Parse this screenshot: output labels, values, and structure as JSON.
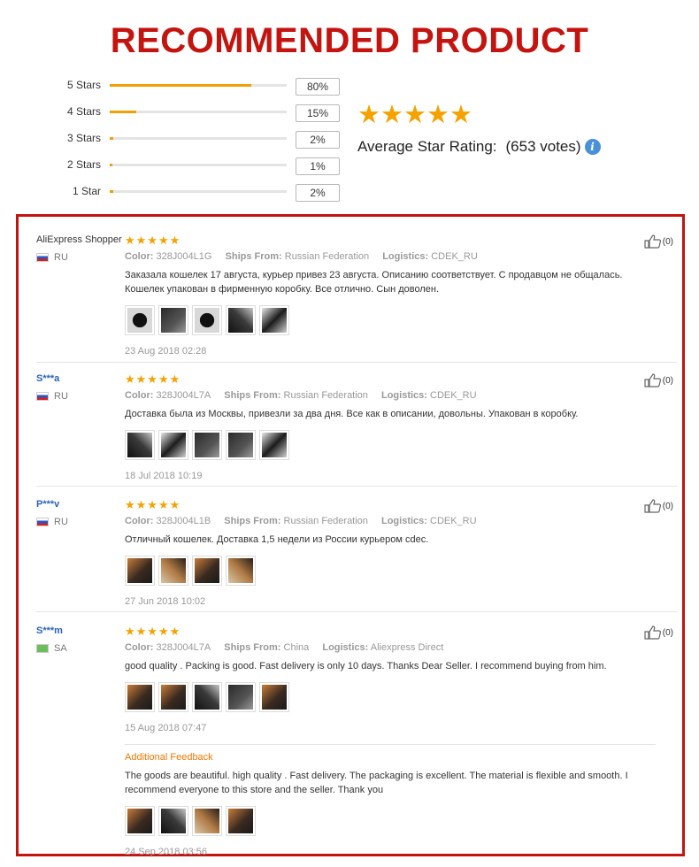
{
  "headline": "RECOMMENDED PRODUCT",
  "rating_breakdown": [
    {
      "label": "5 Stars",
      "percent_text": "80%",
      "fill": 0.8
    },
    {
      "label": "4 Stars",
      "percent_text": "15%",
      "fill": 0.15
    },
    {
      "label": "3 Stars",
      "percent_text": "2%",
      "fill": 0.02
    },
    {
      "label": "2 Stars",
      "percent_text": "1%",
      "fill": 0.01
    },
    {
      "label": "1 Star",
      "percent_text": "2%",
      "fill": 0.02
    }
  ],
  "average": {
    "stars": "★★★★★",
    "label": "Average Star Rating:",
    "votes": "(653 votes)",
    "info_icon": "i"
  },
  "labels": {
    "color": "Color:",
    "ships_from": "Ships From:",
    "logistics": "Logistics:"
  },
  "reviews": [
    {
      "author": "AliExpress Shopper",
      "country": "RU",
      "stars": "★★★★★",
      "color": "328J004L1G",
      "ships_from": "Russian Federation",
      "logistics": "CDEK_RU",
      "text": "Заказала кошелек 17 августа, курьер привез 23 августа. Описанию соответствует. С продавцом не общалась. Кошелек упакован в фирменную коробку. Все отлично. Сын доволен.",
      "photo_count": 5,
      "date": "23 Aug 2018 02:28",
      "likes": "(0)"
    },
    {
      "author": "S***a",
      "country": "RU",
      "stars": "★★★★★",
      "color": "328J004L7A",
      "ships_from": "Russian Federation",
      "logistics": "CDEK_RU",
      "text": "Доставка была из Москвы, привезли за два дня. Все как в описании, довольны. Упакован в коробку.",
      "photo_count": 5,
      "date": "18 Jul 2018 10:19",
      "likes": "(0)"
    },
    {
      "author": "P***v",
      "country": "RU",
      "stars": "★★★★★",
      "color": "328J004L1B",
      "ships_from": "Russian Federation",
      "logistics": "CDEK_RU",
      "text": "Отличный кошелек. Доставка 1,5 недели из России курьером cdec.",
      "photo_count": 4,
      "date": "27 Jun 2018 10:02",
      "likes": "(0)"
    },
    {
      "author": "S***m",
      "country": "SA",
      "stars": "★★★★★",
      "color": "328J004L7A",
      "ships_from": "China",
      "logistics": "Aliexpress Direct",
      "text": "good quality . Packing is good. Fast delivery is only 10 days. Thanks Dear Seller. I recommend buying from him.",
      "photo_count": 5,
      "date": "15 Aug 2018 07:47",
      "likes": "(0)",
      "additional": {
        "title": "Additional Feedback",
        "text": "The goods are beautiful. high quality . Fast delivery. The packaging is excellent. The material is flexible and smooth. I recommend everyone to this store and the seller. Thank you",
        "photo_count": 4,
        "date": "24 Sep 2018 03:56"
      }
    }
  ],
  "colors": {
    "headline_red": "#c41410",
    "star_orange": "#f5a200",
    "bar_orange": "#f0a000",
    "link_blue": "#2a64b8",
    "additional_orange": "#f07800",
    "info_blue": "#4a90d9"
  },
  "icons": {
    "like": "thumbs-up-icon",
    "info": "info-icon",
    "flag_ru": "russia-flag-icon",
    "flag_sa": "saudi-flag-icon"
  }
}
